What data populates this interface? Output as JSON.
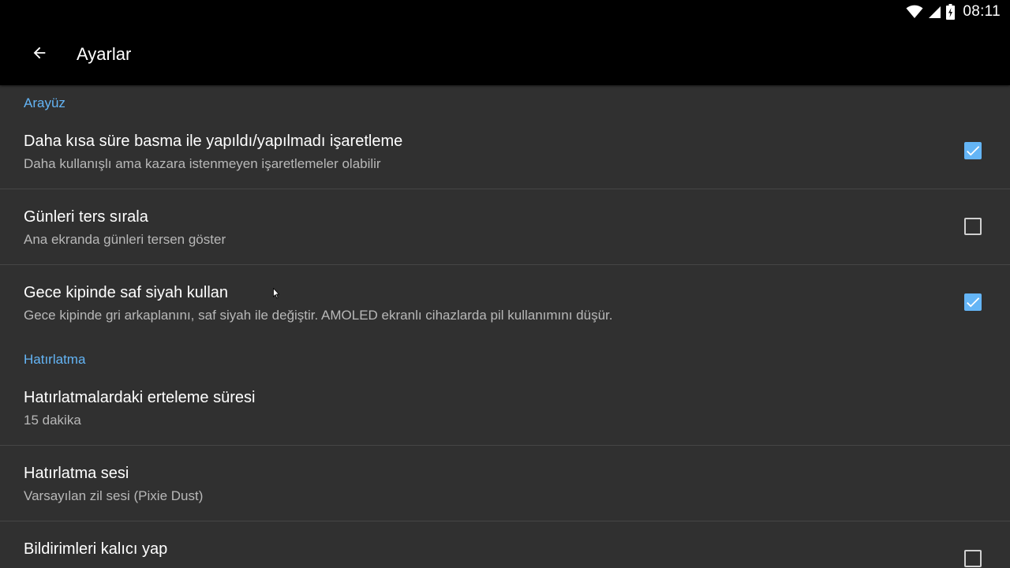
{
  "status_bar": {
    "time": "08:11",
    "icons": [
      "wifi-icon",
      "cell-signal-icon",
      "battery-icon"
    ]
  },
  "app_bar": {
    "back_icon": "arrow-left-icon",
    "title": "Ayarlar"
  },
  "sections": [
    {
      "header": "Arayüz",
      "items": [
        {
          "title": "Daha kısa süre basma ile yapıldı/yapılmadı işaretleme",
          "summary": "Daha kullanışlı ama kazara istenmeyen işaretlemeler olabilir",
          "checked": true
        },
        {
          "title": "Günleri ters sırala",
          "summary": "Ana ekranda günleri tersen göster",
          "checked": false
        },
        {
          "title": "Gece kipinde saf siyah kullan",
          "summary": "Gece kipinde gri arkaplanını, saf siyah ile değiştir. AMOLED ekranlı cihazlarda pil kullanımını düşür.",
          "checked": true
        }
      ]
    },
    {
      "header": "Hatırlatma",
      "items": [
        {
          "title": "Hatırlatmalardaki erteleme süresi",
          "summary": "15 dakika"
        },
        {
          "title": "Hatırlatma sesi",
          "summary": "Varsayılan zil sesi (Pixie Dust)"
        },
        {
          "title": "Bildirimleri kalıcı yap",
          "checked": false
        }
      ]
    }
  ],
  "colors": {
    "background": "#303030",
    "bar": "#000000",
    "accent": "#64b5f6",
    "title_text": "#ffffff",
    "summary_text": "#b8b8b8",
    "divider": "#454545"
  }
}
